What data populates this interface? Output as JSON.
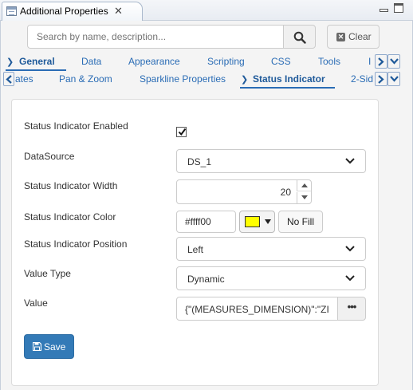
{
  "view": {
    "title": "Additional Properties"
  },
  "search": {
    "placeholder": "Search by name, description...",
    "clear_label": "Clear"
  },
  "tabs_row1": [
    {
      "label": "General",
      "active": true
    },
    {
      "label": "Data"
    },
    {
      "label": "Appearance"
    },
    {
      "label": "Scripting"
    },
    {
      "label": "CSS"
    },
    {
      "label": "Tools"
    },
    {
      "label": "I"
    }
  ],
  "tabs_row2": [
    {
      "label": "ates"
    },
    {
      "label": "Pan & Zoom"
    },
    {
      "label": "Sparkline Properties"
    },
    {
      "label": "Status Indicator",
      "active": true
    },
    {
      "label": "2-Sid"
    }
  ],
  "form": {
    "enabled_label": "Status Indicator Enabled",
    "enabled_checked": true,
    "datasource_label": "DataSource",
    "datasource_value": "DS_1",
    "width_label": "Status Indicator Width",
    "width_value": "20",
    "color_label": "Status Indicator Color",
    "color_value": "#ffff00",
    "color_swatch": "#ffff00",
    "nofill_label": "No Fill",
    "position_label": "Status Indicator Position",
    "position_value": "Left",
    "value_type_label": "Value Type",
    "value_type_value": "Dynamic",
    "value_label": "Value",
    "value_value": "{\"(MEASURES_DIMENSION)\":\"ZI",
    "value_button": "•••"
  },
  "save": {
    "label": "Save"
  },
  "colors": {
    "link": "#2a6cb5",
    "primary": "#337ab7",
    "border": "#cccccc"
  }
}
